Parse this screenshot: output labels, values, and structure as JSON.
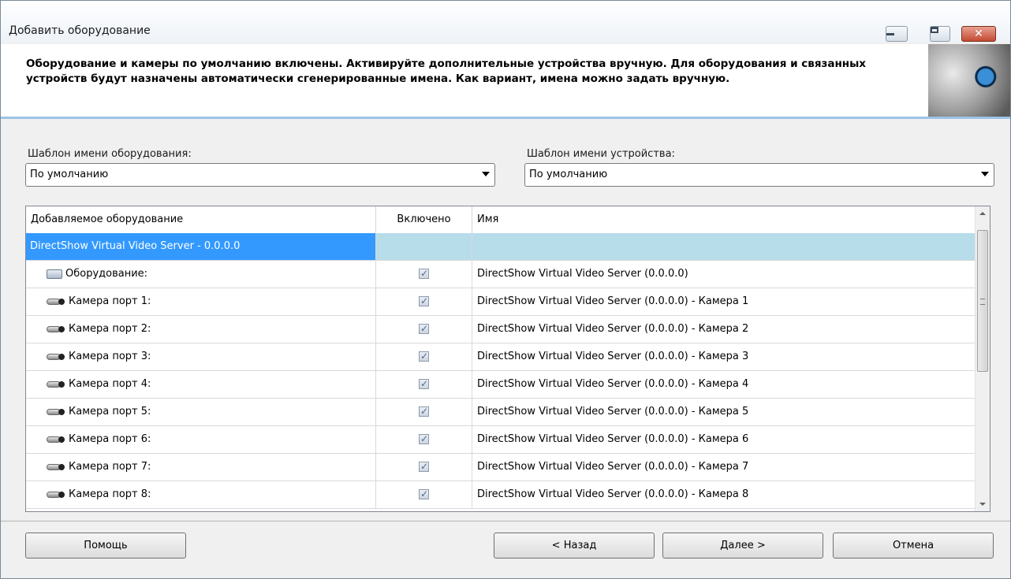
{
  "window": {
    "title": "Добавить оборудование",
    "close_glyph": "✕"
  },
  "header": {
    "text": "Оборудование и камеры по умолчанию включены. Активируйте дополнительные устройства вручную. Для оборудования и связанных устройств будут назначены автоматически сгенерированные имена. Как вариант, имена можно задать вручную.",
    "logo_icon": "wolf-eye-logo"
  },
  "templates": {
    "hardware_label": "Шаблон имени оборудования:",
    "hardware_value": "По умолчанию",
    "device_label": "Шаблон имени устройства:",
    "device_value": "По умолчанию"
  },
  "grid": {
    "columns": [
      "Добавляемое оборудование",
      "Включено",
      "Имя"
    ],
    "group": "DirectShow Virtual Video Server - 0.0.0.0",
    "rows": [
      {
        "label": "Оборудование:",
        "icon": "hardware-icon",
        "enabled": true,
        "name": "DirectShow Virtual Video Server (0.0.0.0)"
      },
      {
        "label": "Камера порт 1:",
        "icon": "camera-icon",
        "enabled": true,
        "name": "DirectShow Virtual Video Server (0.0.0.0) - Камера 1"
      },
      {
        "label": "Камера порт 2:",
        "icon": "camera-icon",
        "enabled": true,
        "name": "DirectShow Virtual Video Server (0.0.0.0) - Камера 2"
      },
      {
        "label": "Камера порт 3:",
        "icon": "camera-icon",
        "enabled": true,
        "name": "DirectShow Virtual Video Server (0.0.0.0) - Камера 3"
      },
      {
        "label": "Камера порт 4:",
        "icon": "camera-icon",
        "enabled": true,
        "name": "DirectShow Virtual Video Server (0.0.0.0) - Камера 4"
      },
      {
        "label": "Камера порт 5:",
        "icon": "camera-icon",
        "enabled": true,
        "name": "DirectShow Virtual Video Server (0.0.0.0) - Камера 5"
      },
      {
        "label": "Камера порт 6:",
        "icon": "camera-icon",
        "enabled": true,
        "name": "DirectShow Virtual Video Server (0.0.0.0) - Камера 6"
      },
      {
        "label": "Камера порт 7:",
        "icon": "camera-icon",
        "enabled": true,
        "name": "DirectShow Virtual Video Server (0.0.0.0) - Камера 7"
      },
      {
        "label": "Камера порт 8:",
        "icon": "camera-icon",
        "enabled": true,
        "name": "DirectShow Virtual Video Server (0.0.0.0) - Камера 8"
      }
    ]
  },
  "buttons": {
    "help": "Помощь",
    "back": "< Назад",
    "next": "Далее >",
    "cancel": "Отмена"
  },
  "colors": {
    "selection": "#3399ff",
    "group_highlight": "#b7dcea",
    "header_rule": "#9cc3e6"
  }
}
